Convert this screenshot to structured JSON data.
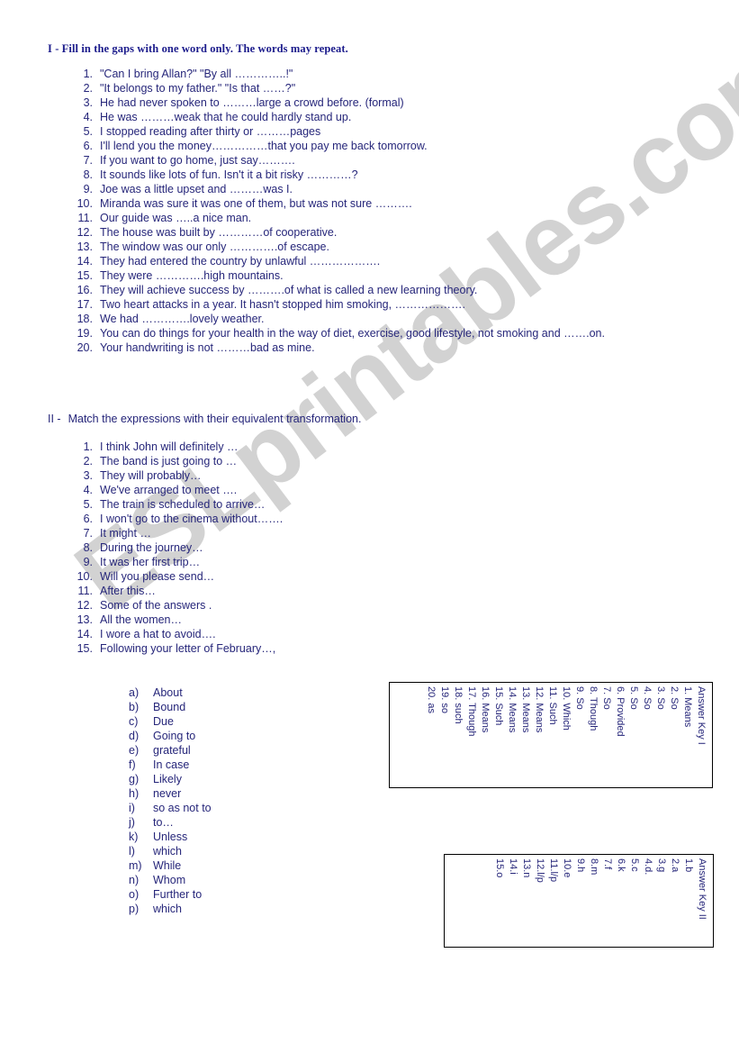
{
  "watermark": {
    "text": "ESLprintables.com"
  },
  "colors": {
    "heading": "#1c1c8c",
    "body_text": "#26267a",
    "box_border": "#000000",
    "watermark": "#d2d2d2",
    "page_background": "#ffffff"
  },
  "section_1": {
    "numeral": "I -",
    "heading": "I - Fill in the gaps with one word only. The words may repeat.",
    "items": [
      {
        "num": "1.",
        "text": "\"Can I bring Allan?\"  \"By all …………..!\""
      },
      {
        "num": "2.",
        "text": "\"It belongs to my father.\"     \"Is that ……?\""
      },
      {
        "num": "3.",
        "text": "He had never spoken to ………large a crowd before. (formal)"
      },
      {
        "num": "4.",
        "text": "He was ………weak that he could hardly stand up."
      },
      {
        "num": "5.",
        "text": "I stopped reading after thirty or ………pages"
      },
      {
        "num": "6.",
        "text": "I'll lend you the money……………that you pay me back tomorrow."
      },
      {
        "num": "7.",
        "text": "If you want to go home, just say………."
      },
      {
        "num": "8.",
        "text": "It sounds like lots of fun. Isn't it a bit risky …………?"
      },
      {
        "num": "9.",
        "text": "Joe was a little upset and ………was I."
      },
      {
        "num": "10.",
        "text": "Miranda was sure it was one of them, but was not sure ………."
      },
      {
        "num": "11.",
        "text": "Our guide was …..a nice man."
      },
      {
        "num": "12.",
        "text": "The house was built by …………of cooperative."
      },
      {
        "num": "13.",
        "text": "The window was our only ………….of escape."
      },
      {
        "num": "14.",
        "text": "They had entered the country by unlawful ………………."
      },
      {
        "num": "15.",
        "text": "They were ………….high mountains."
      },
      {
        "num": "16.",
        "text": "They will achieve success by ……….of what is called a new learning theory."
      },
      {
        "num": "17.",
        "text": "Two heart attacks in a year. It hasn't stopped him smoking, ………………."
      },
      {
        "num": "18.",
        "text": "We had ………….lovely weather."
      },
      {
        "num": "19.",
        "text": "You can do things for your health in the way of diet, exercise, good lifestyle, not smoking and …….on."
      },
      {
        "num": "20.",
        "text": "Your handwriting is not ………bad as mine."
      }
    ]
  },
  "section_2": {
    "numeral": "II -",
    "heading_text": "Match the expressions with their equivalent transformation.",
    "items": [
      {
        "num": "1.",
        "text": "I think John will definitely …"
      },
      {
        "num": "2.",
        "text": "The band is just going to …"
      },
      {
        "num": "3.",
        "text": "They will probably…"
      },
      {
        "num": "4.",
        "text": "We've arranged to meet …."
      },
      {
        "num": "5.",
        "text": "The train is scheduled to arrive…"
      },
      {
        "num": "6.",
        "text": "I won't go to the cinema without……."
      },
      {
        "num": "7.",
        "text": "It might …"
      },
      {
        "num": "8.",
        "text": "During the journey…"
      },
      {
        "num": "9.",
        "text": "It was her first trip…"
      },
      {
        "num": "10.",
        "text": "Will you please send…"
      },
      {
        "num": "11.",
        "text": "After this…"
      },
      {
        "num": "12.",
        "text": "Some of the answers ."
      },
      {
        "num": "13.",
        "text": "All the women…"
      },
      {
        "num": "14.",
        "text": "I wore a hat to avoid…."
      },
      {
        "num": "15.",
        "text": "Following your letter of February…,"
      }
    ],
    "options": [
      {
        "letter": "a)",
        "text": "About"
      },
      {
        "letter": "b)",
        "text": "Bound"
      },
      {
        "letter": "c)",
        "text": "Due"
      },
      {
        "letter": "d)",
        "text": "Going to"
      },
      {
        "letter": "e)",
        "text": "grateful"
      },
      {
        "letter": "f)",
        "text": "In case"
      },
      {
        "letter": "g)",
        "text": "Likely"
      },
      {
        "letter": "h)",
        "text": "never"
      },
      {
        "letter": "i)",
        "text": "so as not to"
      },
      {
        "letter": "j)",
        "text": "to…"
      },
      {
        "letter": "k)",
        "text": "Unless"
      },
      {
        "letter": "l)",
        "text": "which"
      },
      {
        "letter": "m)",
        "text": "While"
      },
      {
        "letter": "n)",
        "text": "Whom"
      },
      {
        "letter": "o)",
        "text": "Further to"
      },
      {
        "letter": "p)",
        "text": "which"
      }
    ]
  },
  "answer_key_1": {
    "title": "Answer Key I",
    "entries": [
      "1. Means",
      "2. So",
      "3. So",
      "4. So",
      "5. So",
      "6. Provided",
      "7. So",
      "8. Though",
      "9. So",
      "10. Which",
      "11. Such",
      "12. Means",
      "13. Means",
      "14. Means",
      "15. Such",
      "16. Means",
      "17. Though",
      "18. such",
      "19. so",
      "20. as"
    ]
  },
  "answer_key_2": {
    "title": "Answer Key II",
    "entries": [
      "1.b",
      "2.a",
      "3.g",
      "4.d.",
      "5.c",
      "6.k",
      "7.f",
      "8.m",
      "9.h",
      "10.e",
      "11.l/p",
      "12.l/p",
      "13.n",
      "14.i",
      "15.o"
    ]
  }
}
